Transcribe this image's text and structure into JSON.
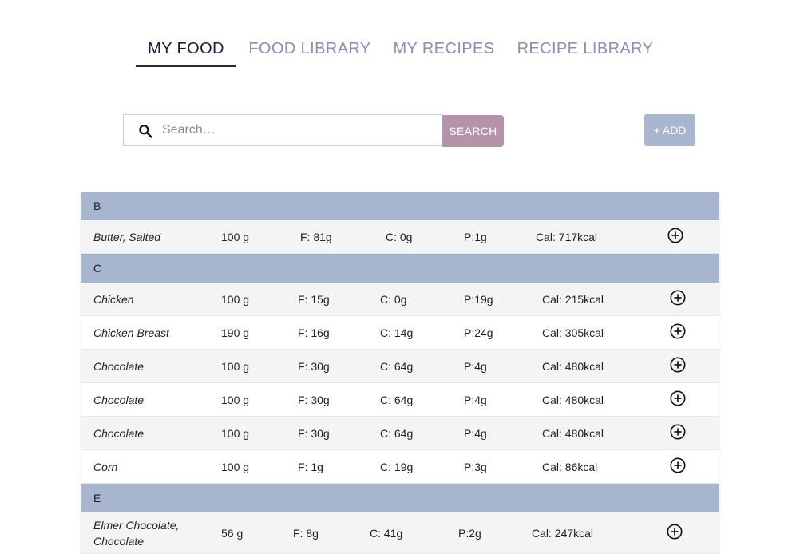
{
  "tabs": [
    {
      "label": "MY FOOD"
    },
    {
      "label": "FOOD LIBRARY"
    },
    {
      "label": "MY RECIPES"
    },
    {
      "label": "RECIPE LIBRARY"
    }
  ],
  "active_tab": "MY FOOD",
  "search": {
    "placeholder": "Search…",
    "value": "",
    "button_label": "SEARCH"
  },
  "add_label": "+ ADD",
  "icons": {
    "search": "search-icon",
    "add": "plus-circle-icon"
  },
  "colors": {
    "group_header": "#a7b5cf",
    "search_button": "#b593a8",
    "add_button": "#a8b6cf",
    "active_tab": "#1f1c3e",
    "inactive_tab": "#8e8bb5"
  },
  "groups": [
    {
      "letter": "B",
      "items": [
        {
          "name": "Butter, Salted",
          "qty": "100 g",
          "fat": "F: 81g",
          "carbs": "C: 0g",
          "protein": "P:1g",
          "cal": "Cal: 717kcal"
        }
      ]
    },
    {
      "letter": "C",
      "items": [
        {
          "name": "Chicken",
          "qty": "100 g",
          "fat": "F: 15g",
          "carbs": "C: 0g",
          "protein": "P:19g",
          "cal": "Cal: 215kcal"
        },
        {
          "name": "Chicken Breast",
          "qty": "190 g",
          "fat": "F: 16g",
          "carbs": "C: 14g",
          "protein": "P:24g",
          "cal": "Cal: 305kcal"
        },
        {
          "name": "Chocolate",
          "qty": "100 g",
          "fat": "F: 30g",
          "carbs": "C: 64g",
          "protein": "P:4g",
          "cal": "Cal: 480kcal"
        },
        {
          "name": "Chocolate",
          "qty": "100 g",
          "fat": "F: 30g",
          "carbs": "C: 64g",
          "protein": "P:4g",
          "cal": "Cal: 480kcal"
        },
        {
          "name": "Chocolate",
          "qty": "100 g",
          "fat": "F: 30g",
          "carbs": "C: 64g",
          "protein": "P:4g",
          "cal": "Cal: 480kcal"
        },
        {
          "name": "Corn",
          "qty": "100 g",
          "fat": "F: 1g",
          "carbs": "C: 19g",
          "protein": "P:3g",
          "cal": "Cal: 86kcal"
        }
      ]
    },
    {
      "letter": "E",
      "items": [
        {
          "name": "Elmer Chocolate, Chocolate",
          "qty": "56 g",
          "fat": "F: 8g",
          "carbs": "C: 41g",
          "protein": "P:2g",
          "cal": "Cal: 247kcal"
        }
      ]
    }
  ]
}
